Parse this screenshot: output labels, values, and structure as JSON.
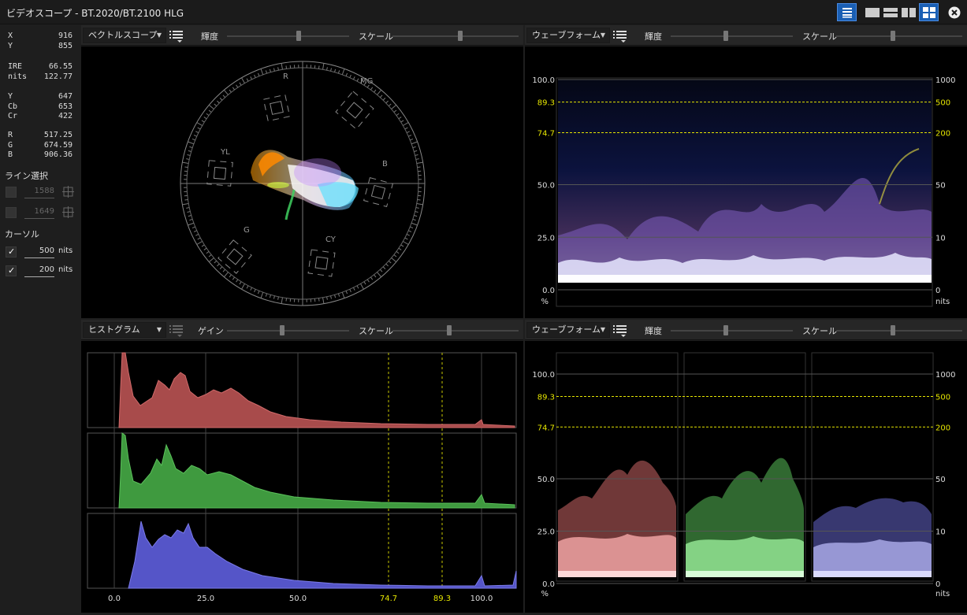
{
  "window": {
    "title": "ビデオスコープ - BT.2020/BT.2100 HLG"
  },
  "sidebar": {
    "x": {
      "label": "X",
      "value": "916"
    },
    "y": {
      "label": "Y",
      "value": "855"
    },
    "ire": {
      "label": "IRE",
      "value": "66.55"
    },
    "nits": {
      "label": "nits",
      "value": "122.77"
    },
    "yv": {
      "label": "Y",
      "value": "647"
    },
    "cb": {
      "label": "Cb",
      "value": "653"
    },
    "cr": {
      "label": "Cr",
      "value": "422"
    },
    "r": {
      "label": "R",
      "value": "517.25"
    },
    "g": {
      "label": "G",
      "value": "674.59"
    },
    "b": {
      "label": "B",
      "value": "906.36"
    },
    "line_select_label": "ライン選択",
    "line1": "1588",
    "line2": "1649",
    "cursor_label": "カーソル",
    "cursor1": "500",
    "cursor2": "200",
    "cursor_unit": "nits"
  },
  "panels": {
    "vectorscope": {
      "dropdown": "ベクトルスコープ",
      "slider1": "輝度",
      "slider2": "スケール",
      "targets": [
        "R",
        "MG",
        "B",
        "CY",
        "G",
        "YL"
      ]
    },
    "waveform_top": {
      "dropdown": "ウェーブフォーム",
      "slider1": "輝度",
      "slider2": "スケール"
    },
    "histogram": {
      "dropdown": "ヒストグラム",
      "slider1": "ゲイン",
      "slider2": "スケール",
      "x_ticks": [
        "0.0",
        "25.0",
        "50.0",
        "74.7",
        "89.3",
        "100.0"
      ]
    },
    "waveform_bottom": {
      "dropdown": "ウェーブフォーム",
      "slider1": "輝度",
      "slider2": "スケール"
    }
  },
  "waveform_axis": {
    "left": [
      "100.0",
      "89.3",
      "74.7",
      "50.0",
      "25.0",
      "0.0"
    ],
    "left_unit": "%",
    "right": [
      "1000",
      "500",
      "200",
      "50",
      "10",
      "0"
    ],
    "right_unit": "nits"
  },
  "colors": {
    "accent": "#1565c0",
    "ref_line": "#e6e600",
    "hist_red": "#a84b4b",
    "hist_green": "#3f9a3f",
    "hist_blue": "#5555c8"
  }
}
